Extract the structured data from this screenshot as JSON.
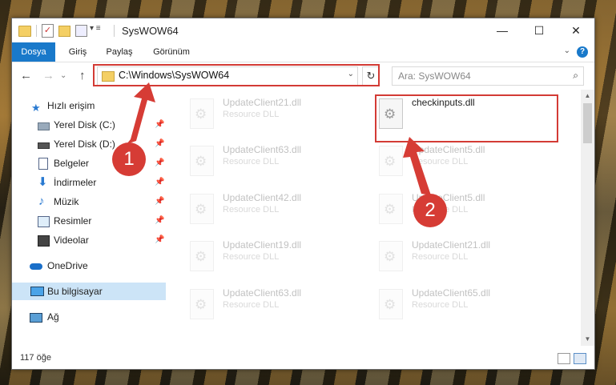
{
  "window": {
    "title": "SysWOW64",
    "controls": {
      "minimize": "—",
      "maximize": "☐",
      "close": "✕"
    }
  },
  "ribbon": {
    "tabs": [
      "Dosya",
      "Giriş",
      "Paylaş",
      "Görünüm"
    ],
    "help": "?"
  },
  "nav": {
    "address": "C:\\Windows\\SysWOW64",
    "search_placeholder": "Ara: SysWOW64"
  },
  "sidebar": {
    "items": [
      {
        "label": "Hızlı erişim",
        "icon": "star-icon",
        "pinned": false
      },
      {
        "label": "Yerel Disk (C:)",
        "icon": "drive-icon",
        "pinned": true
      },
      {
        "label": "Yerel Disk (D:)",
        "icon": "drive-icon",
        "pinned": true
      },
      {
        "label": "Belgeler",
        "icon": "documents-icon",
        "pinned": true
      },
      {
        "label": "İndirmeler",
        "icon": "download-icon",
        "pinned": true
      },
      {
        "label": "Müzik",
        "icon": "music-icon",
        "pinned": true
      },
      {
        "label": "Resimler",
        "icon": "pictures-icon",
        "pinned": true
      },
      {
        "label": "Videolar",
        "icon": "videos-icon",
        "pinned": true
      },
      {
        "label": "OneDrive",
        "icon": "cloud-icon",
        "pinned": false
      },
      {
        "label": "Bu bilgisayar",
        "icon": "computer-icon",
        "pinned": false,
        "selected": true
      },
      {
        "label": "Ağ",
        "icon": "network-icon",
        "pinned": false
      }
    ]
  },
  "files": {
    "left": [
      {
        "name": "UpdateClient21.dll",
        "type": "Resource DLL"
      },
      {
        "name": "UpdateClient63.dll",
        "type": "Resource DLL"
      },
      {
        "name": "UpdateClient42.dll",
        "type": "Resource DLL"
      },
      {
        "name": "UpdateClient19.dll",
        "type": "Resource DLL"
      },
      {
        "name": "UpdateClient63.dll",
        "type": "Resource DLL"
      }
    ],
    "right": [
      {
        "name": "checkinputs.dll",
        "type": "",
        "highlighted": true
      },
      {
        "name": "UpdateClient5.dll",
        "type": "Resource DLL"
      },
      {
        "name": "UpdateClient5.dll",
        "type": "Resource DLL"
      },
      {
        "name": "UpdateClient21.dll",
        "type": "Resource DLL"
      },
      {
        "name": "UpdateClient65.dll",
        "type": "Resource DLL"
      }
    ]
  },
  "status": {
    "item_count": "117 öğe"
  },
  "annotations": {
    "step1": "1",
    "step2": "2",
    "color": "#d63c35"
  }
}
